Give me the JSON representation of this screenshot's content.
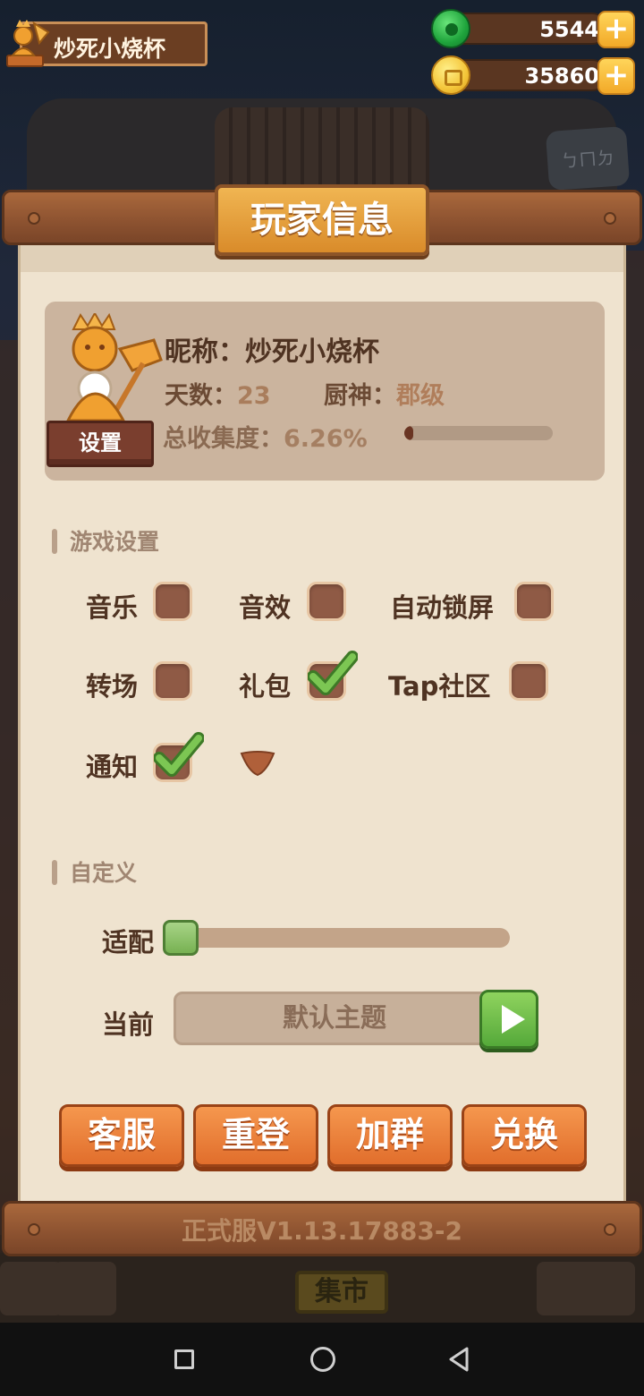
{
  "hud": {
    "player_name": "炒死小烧杯",
    "jade": "5544",
    "coins": "35860",
    "jade_icon": "jade-icon",
    "coin_icon": "coin-icon",
    "plus_label": "+"
  },
  "background": {
    "sign_text": "ㄅㄇㄉ",
    "market_label": "集市"
  },
  "panel": {
    "title": "玩家信息",
    "version": "正式服V1.13.17883-2"
  },
  "profile": {
    "nickname_label": "昵称：",
    "nickname": "炒死小烧杯",
    "days_label": "天数：",
    "days": "23",
    "chef_label": "厨神：",
    "chef_rank": "郡级",
    "collection_label": "总收集度：",
    "collection": "6.26%",
    "collection_fraction": 0.0626,
    "settings_button": "设置"
  },
  "game_settings": {
    "header": "游戏设置",
    "options": [
      {
        "label": "音乐",
        "checked": false
      },
      {
        "label": "音效",
        "checked": false
      },
      {
        "label": "自动锁屏",
        "checked": false
      },
      {
        "label": "转场",
        "checked": false
      },
      {
        "label": "礼包",
        "checked": true
      },
      {
        "label": "Tap社区",
        "checked": false
      },
      {
        "label": "通知",
        "checked": true
      }
    ]
  },
  "custom": {
    "header": "自定义",
    "fit_label": "适配",
    "slider_fraction": 0.0,
    "current_label": "当前",
    "theme_value": "默认主题"
  },
  "buttons": {
    "service": "客服",
    "relogin": "重登",
    "join_group": "加群",
    "redeem": "兑换"
  },
  "colors": {
    "accent_orange": "#e16e2c",
    "check_green": "#6dbb4a",
    "wood": "#8c5230",
    "panel_bg": "#efe3cf"
  }
}
